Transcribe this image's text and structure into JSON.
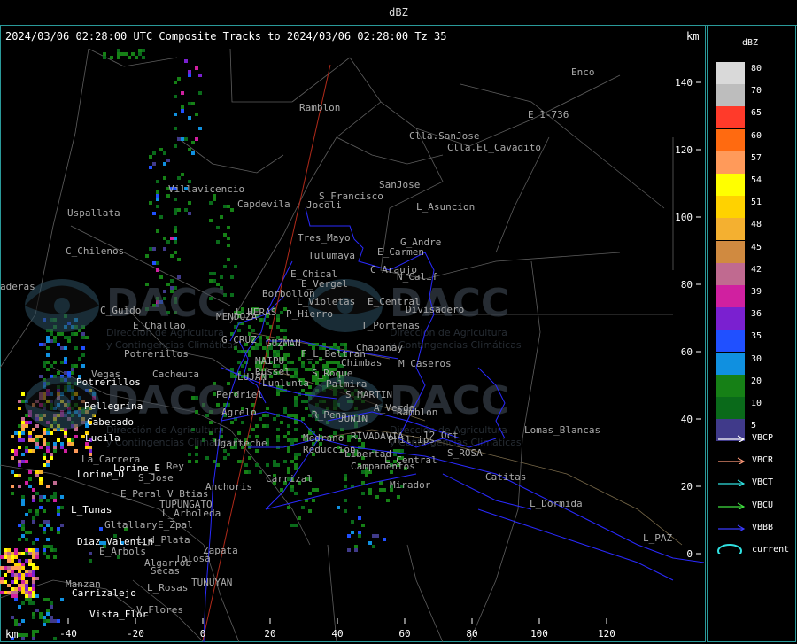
{
  "header": {
    "unit_title": "dBZ"
  },
  "headline": "2024/03/06 02:28:00 UTC Composite Tracks to 2024/03/06 02:28:00 Tz 35",
  "axis_unit": "km",
  "x_ticks": [
    "-40",
    "-20",
    "0",
    "20",
    "40",
    "60",
    "80",
    "100",
    "120"
  ],
  "y_ticks": [
    "140",
    "120",
    "100",
    "80",
    "60",
    "40",
    "20",
    "0"
  ],
  "legend": {
    "levels": [
      {
        "label": "80",
        "color": "#d9d9d9"
      },
      {
        "label": "70",
        "color": "#bdbdbd"
      },
      {
        "label": "65",
        "color": "#ff3a2a"
      },
      {
        "label": "60",
        "color": "#ff6a10"
      },
      {
        "label": "57",
        "color": "#ff9a5a"
      },
      {
        "label": "54",
        "color": "#ffff00"
      },
      {
        "label": "51",
        "color": "#ffd200"
      },
      {
        "label": "48",
        "color": "#f4b030"
      },
      {
        "label": "45",
        "color": "#d08a40"
      },
      {
        "label": "42",
        "color": "#c06a90"
      },
      {
        "label": "39",
        "color": "#d020a0"
      },
      {
        "label": "36",
        "color": "#7a20d0"
      },
      {
        "label": "35",
        "color": "#2050ff"
      },
      {
        "label": "30",
        "color": "#1090e0"
      },
      {
        "label": "20",
        "color": "#168016"
      },
      {
        "label": "10",
        "color": "#0a6a1a"
      },
      {
        "label": "5",
        "color": "#403a8a"
      }
    ],
    "tracks": [
      {
        "label": "VBCP",
        "color": "#ffffff",
        "kind": "arrow"
      },
      {
        "label": "VBCR",
        "color": "#ff9a7a",
        "kind": "arrow"
      },
      {
        "label": "VBCT",
        "color": "#30e0e0",
        "kind": "arrow"
      },
      {
        "label": "VBCU",
        "color": "#40e040",
        "kind": "arrow"
      },
      {
        "label": "VBBB",
        "color": "#3a3aff",
        "kind": "arrow"
      },
      {
        "label": "current",
        "color": "#30e0e0",
        "kind": "ellipse"
      }
    ]
  },
  "watermark": {
    "name": "DACC",
    "subtitle_1": "Dirección de Agricultura",
    "subtitle_2": "y Contingencias Climáticas"
  },
  "places": [
    {
      "n": "Enco",
      "c": "#aaaaaa"
    },
    {
      "n": "Ramblon",
      "c": "#aaaaaa"
    },
    {
      "n": "E_1-736",
      "c": "#aaaaaa"
    },
    {
      "n": "Clla.SanJose",
      "c": "#aaaaaa"
    },
    {
      "n": "Clla.El_Cavadito",
      "c": "#aaaaaa"
    },
    {
      "n": "Villavicencio",
      "c": "#aaaaaa"
    },
    {
      "n": "SanJose",
      "c": "#aaaaaa"
    },
    {
      "n": "S_Francisco",
      "c": "#aaaaaa"
    },
    {
      "n": "Jocoli",
      "c": "#aaaaaa"
    },
    {
      "n": "Capdevila",
      "c": "#aaaaaa"
    },
    {
      "n": "L_Asuncion",
      "c": "#aaaaaa"
    },
    {
      "n": "Uspallata",
      "c": "#aaaaaa"
    },
    {
      "n": "Tres_Mayo",
      "c": "#aaaaaa"
    },
    {
      "n": "G_Andre",
      "c": "#aaaaaa"
    },
    {
      "n": "Tulumaya",
      "c": "#aaaaaa"
    },
    {
      "n": "E_Carmen",
      "c": "#aaaaaa"
    },
    {
      "n": "C_Chilenos",
      "c": "#aaaaaa"
    },
    {
      "n": "C_Araujo",
      "c": "#aaaaaa"
    },
    {
      "n": "E_Chical",
      "c": "#aaaaaa"
    },
    {
      "n": "N_Calif",
      "c": "#aaaaaa"
    },
    {
      "n": "E_Vergel",
      "c": "#aaaaaa"
    },
    {
      "n": "Borbollon",
      "c": "#aaaaaa"
    },
    {
      "n": "aderas",
      "c": "#aaaaaa"
    },
    {
      "n": "L_Violetas",
      "c": "#aaaaaa"
    },
    {
      "n": "E_Central",
      "c": "#aaaaaa"
    },
    {
      "n": "C_Guido",
      "c": "#aaaaaa"
    },
    {
      "n": "MENDOZA",
      "c": "#aaaaaa"
    },
    {
      "n": "L_HERAS",
      "c": "#aaaaaa"
    },
    {
      "n": "P_Hierro",
      "c": "#aaaaaa"
    },
    {
      "n": "Divisadero",
      "c": "#aaaaaa"
    },
    {
      "n": "E_Challao",
      "c": "#aaaaaa"
    },
    {
      "n": "T_Porteñas",
      "c": "#aaaaaa"
    },
    {
      "n": "G_CRUZ",
      "c": "#aaaaaa"
    },
    {
      "n": "GUZMAN",
      "c": "#aaaaaa"
    },
    {
      "n": "MAIPU",
      "c": "#aaaaaa"
    },
    {
      "n": "Chapanay",
      "c": "#aaaaaa"
    },
    {
      "n": "F_L_Beltran",
      "c": "#aaaaaa"
    },
    {
      "n": "Potrerillos",
      "c": "#aaaaaa"
    },
    {
      "n": "Chimbas",
      "c": "#aaaaaa"
    },
    {
      "n": "M_Caseros",
      "c": "#aaaaaa"
    },
    {
      "n": "Vegas",
      "c": "#aaaaaa"
    },
    {
      "n": "Cacheuta",
      "c": "#aaaaaa"
    },
    {
      "n": "Russel",
      "c": "#aaaaaa"
    },
    {
      "n": "S_Roque",
      "c": "#aaaaaa"
    },
    {
      "n": "Lunlunta",
      "c": "#aaaaaa"
    },
    {
      "n": "LUJAN",
      "c": "#aaaaaa"
    },
    {
      "n": "Palmira",
      "c": "#aaaaaa"
    },
    {
      "n": "Potrerillos",
      "c": "#ffffff"
    },
    {
      "n": "Perdriel",
      "c": "#aaaaaa"
    },
    {
      "n": "S_MARTIN",
      "c": "#aaaaaa"
    },
    {
      "n": "Pellegrina",
      "c": "#ffffff"
    },
    {
      "n": "A_Verde",
      "c": "#aaaaaa"
    },
    {
      "n": "Agrelo",
      "c": "#aaaaaa"
    },
    {
      "n": "Ramblon",
      "c": "#aaaaaa"
    },
    {
      "n": "R_Pena",
      "c": "#aaaaaa"
    },
    {
      "n": "JUNIN",
      "c": "#aaaaaa"
    },
    {
      "n": "Cabecado",
      "c": "#ffffff"
    },
    {
      "n": "Lomas_Blancas",
      "c": "#aaaaaa"
    },
    {
      "n": "RIVADAVIA",
      "c": "#aaaaaa"
    },
    {
      "n": "12_Oct",
      "c": "#aaaaaa"
    },
    {
      "n": "Phillips",
      "c": "#aaaaaa"
    },
    {
      "n": "Lucila",
      "c": "#ffffff"
    },
    {
      "n": "Medrano",
      "c": "#aaaaaa"
    },
    {
      "n": "Ugarteche",
      "c": "#aaaaaa"
    },
    {
      "n": "Reduccion",
      "c": "#aaaaaa"
    },
    {
      "n": "S_ROSA",
      "c": "#aaaaaa"
    },
    {
      "n": "La_Carrera",
      "c": "#aaaaaa"
    },
    {
      "n": "Libertad",
      "c": "#aaaaaa"
    },
    {
      "n": "L_Central",
      "c": "#aaaaaa"
    },
    {
      "n": "Lorine_E",
      "c": "#ffffff"
    },
    {
      "n": "Rey",
      "c": "#aaaaaa"
    },
    {
      "n": "Campamentos",
      "c": "#aaaaaa"
    },
    {
      "n": "Lorine_O",
      "c": "#ffffff"
    },
    {
      "n": "S_Jose",
      "c": "#aaaaaa"
    },
    {
      "n": "Carrizal",
      "c": "#aaaaaa"
    },
    {
      "n": "Catitas",
      "c": "#aaaaaa"
    },
    {
      "n": "Mirador",
      "c": "#aaaaaa"
    },
    {
      "n": "E_Peral",
      "c": "#aaaaaa"
    },
    {
      "n": "V_Btias",
      "c": "#aaaaaa"
    },
    {
      "n": "Anchoris",
      "c": "#aaaaaa"
    },
    {
      "n": "TUPUNGATO",
      "c": "#aaaaaa"
    },
    {
      "n": "L_Dormida",
      "c": "#aaaaaa"
    },
    {
      "n": "L_Tunas",
      "c": "#ffffff"
    },
    {
      "n": "L_Arboleda",
      "c": "#aaaaaa"
    },
    {
      "n": "Gltallary",
      "c": "#aaaaaa"
    },
    {
      "n": "E_Zpal",
      "c": "#aaaaaa"
    },
    {
      "n": "Diaz_Valentin",
      "c": "#ffffff"
    },
    {
      "n": "L_d_Plata",
      "c": "#aaaaaa"
    },
    {
      "n": "L_PAZ",
      "c": "#aaaaaa"
    },
    {
      "n": "E_Arbols",
      "c": "#aaaaaa"
    },
    {
      "n": "Zapata",
      "c": "#aaaaaa"
    },
    {
      "n": "Algarrob",
      "c": "#aaaaaa"
    },
    {
      "n": "Tolosa",
      "c": "#aaaaaa"
    },
    {
      "n": "Secas",
      "c": "#aaaaaa"
    },
    {
      "n": "Manzan",
      "c": "#aaaaaa"
    },
    {
      "n": "Carrizalejo",
      "c": "#ffffff"
    },
    {
      "n": "L_Rosas",
      "c": "#aaaaaa"
    },
    {
      "n": "TUNUYAN",
      "c": "#aaaaaa"
    },
    {
      "n": "Vista_Flor",
      "c": "#ffffff"
    },
    {
      "n": "V_Flores",
      "c": "#aaaaaa"
    }
  ]
}
